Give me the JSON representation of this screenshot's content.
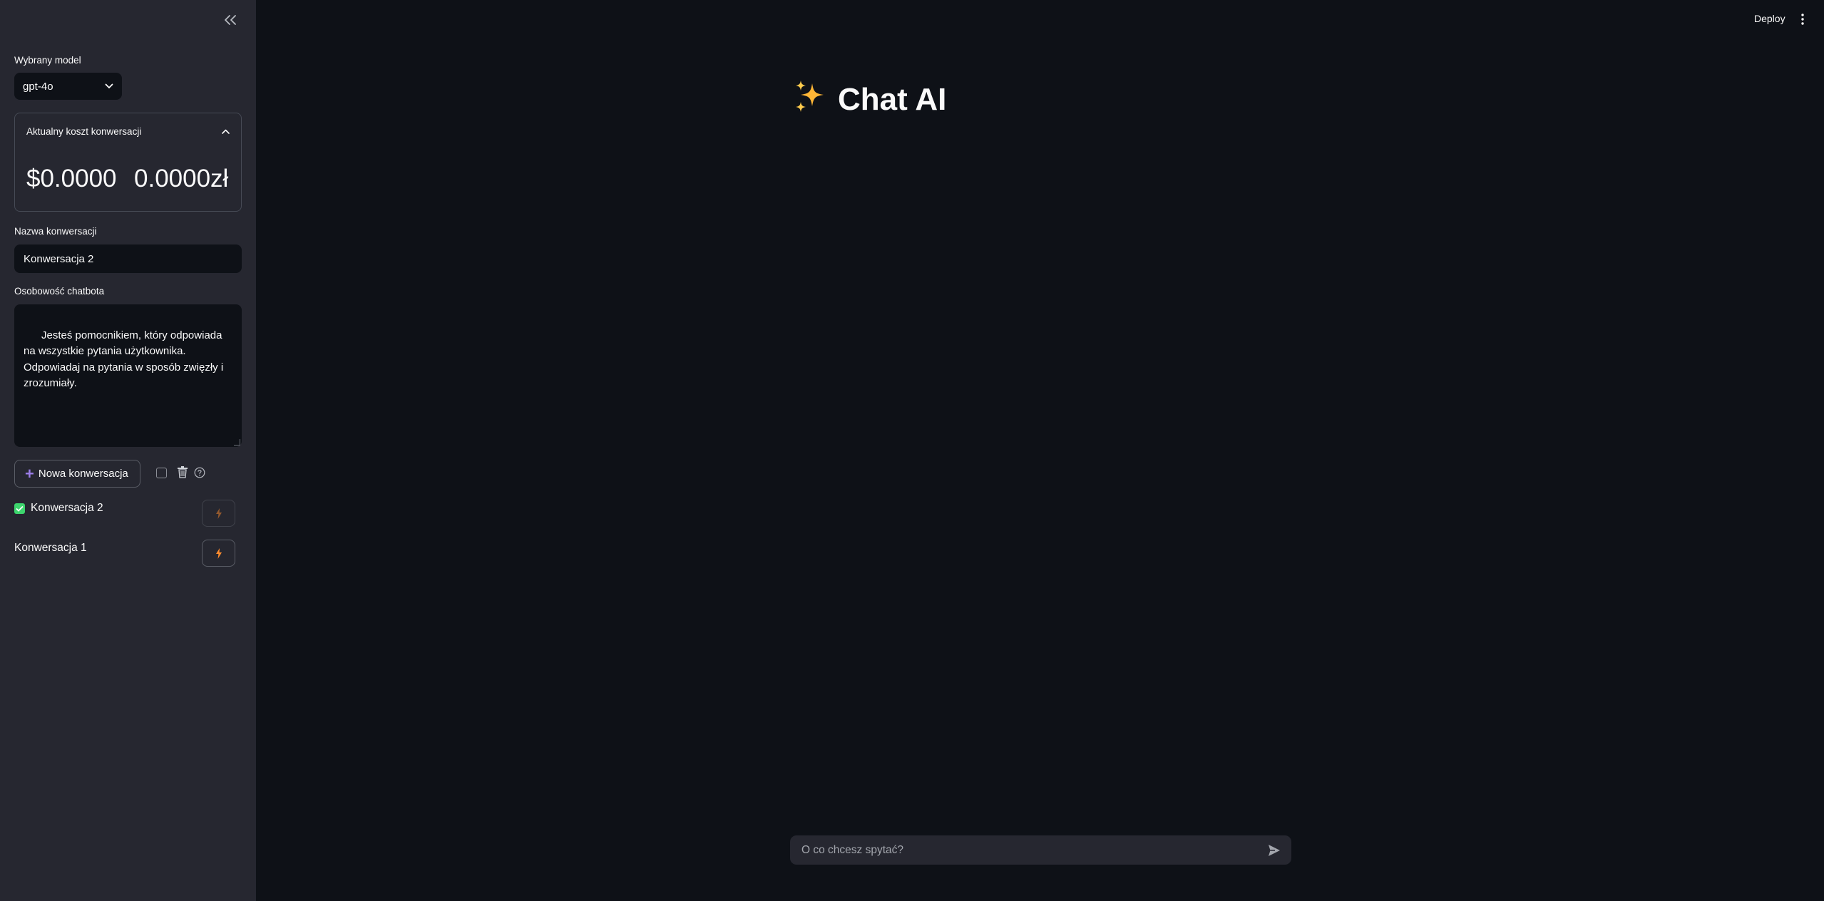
{
  "sidebar": {
    "model_label": "Wybrany model",
    "model_value": "gpt-4o",
    "cost_expander_title": "Aktualny koszt konwersacji",
    "cost_usd": "$0.0000",
    "cost_pln": "0.0000zł",
    "conversation_name_label": "Nazwa konwersacji",
    "conversation_name_value": "Konwersacja 2",
    "personality_label": "Osobowość chatbota",
    "personality_value": "Jesteś pomocnikiem, który odpowiada na wszystkie pytania użytkownika.\nOdpowiadaj na pytania w sposób zwięzły i zrozumiały.",
    "new_conversation_button": "Nowa konwersacja",
    "conversations": [
      {
        "label": "Konwersacja 2",
        "active": true
      },
      {
        "label": "Konwersacja 1",
        "active": false
      }
    ]
  },
  "header": {
    "deploy_label": "Deploy"
  },
  "main": {
    "title_emoji": "✨",
    "title": "Chat AI",
    "chat_placeholder": "O co chcesz spytać?"
  },
  "colors": {
    "background": "#0e1117",
    "sidebar": "#262730",
    "accent_purple": "#9b7de8",
    "bolt_orange": "#ff8c2e",
    "check_green": "#3dd56d"
  }
}
